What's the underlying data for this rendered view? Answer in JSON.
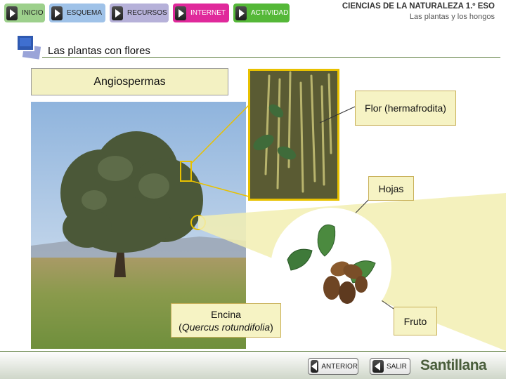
{
  "nav": {
    "items": [
      {
        "label": "INICIO"
      },
      {
        "label": "ESQUEMA"
      },
      {
        "label": "RECURSOS"
      },
      {
        "label": "INTERNET"
      },
      {
        "label": "ACTIVIDAD"
      }
    ]
  },
  "course": {
    "title": "CIENCIAS DE LA NATURALEZA 1.º ESO",
    "subtitle": "Las plantas y los hongos"
  },
  "section": {
    "title": "Las plantas con flores"
  },
  "labels": {
    "group": "Angiospermas",
    "flower": "Flor (hermafrodita)",
    "leaves": "Hojas",
    "fruit": "Fruto",
    "species_common": "Encina",
    "species_open": "(",
    "species_latin": "Quercus rotundifolia",
    "species_close": ")"
  },
  "footer": {
    "prev_label": "ANTERIOR",
    "exit_label": "SALIR",
    "brand": "Santillana"
  },
  "colors": {
    "accent_green": "#5a7a3a",
    "label_bg": "#f6f3c4",
    "highlight": "#e8c100",
    "nav_inicio": "#9dd08c",
    "nav_esquema": "#9fc2e8",
    "nav_recursos": "#b6b1d9",
    "nav_internet": "#e0299b",
    "nav_actividad": "#55b838"
  },
  "icons": {
    "nav": "play-icon",
    "section": "unit-icon",
    "back": "back-icon"
  }
}
